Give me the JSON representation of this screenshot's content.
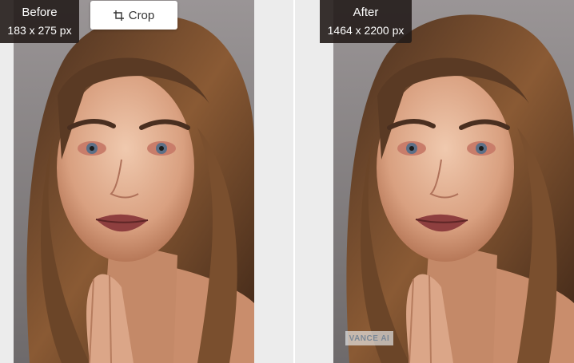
{
  "before": {
    "title": "Before",
    "dimensions": "183 x 275 px"
  },
  "after": {
    "title": "After",
    "dimensions": "1464 x 2200 px"
  },
  "toolbar": {
    "crop_label": "Crop",
    "crop_icon": "crop-icon"
  },
  "watermark": {
    "text": "VANCE AI"
  },
  "colors": {
    "badge_bg": "#231c1a",
    "page_bg": "#ececec",
    "button_bg": "#ffffff"
  }
}
